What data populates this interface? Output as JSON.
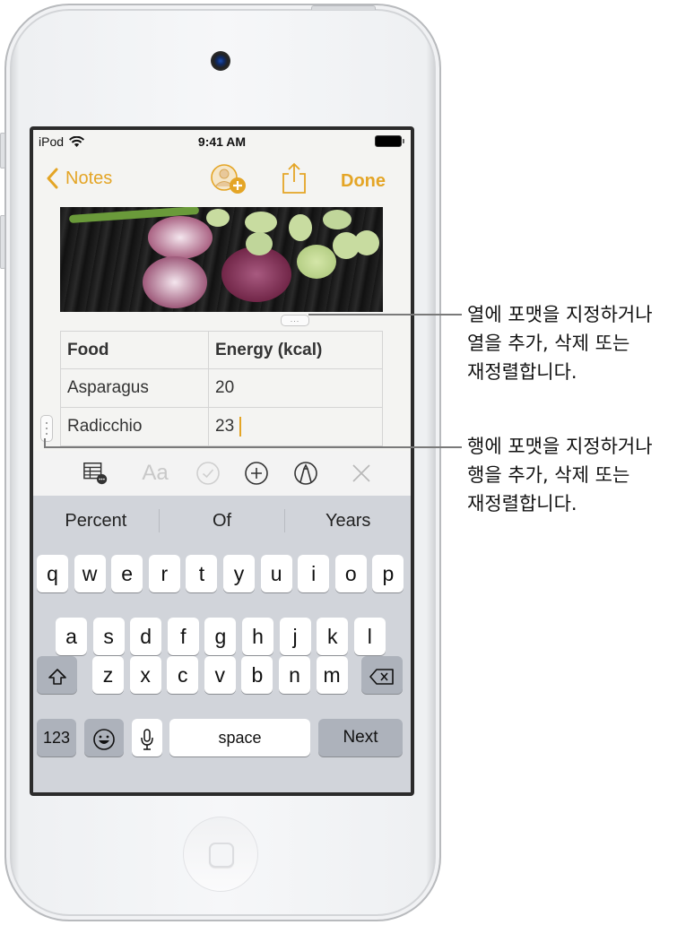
{
  "status_bar": {
    "carrier": "iPod",
    "time": "9:41 AM",
    "icons": [
      "wifi-icon",
      "battery-icon"
    ]
  },
  "nav_bar": {
    "back_label": "Notes",
    "done_label": "Done",
    "icons": [
      "chevron-left-icon",
      "add-collaborator-icon",
      "share-icon"
    ],
    "accent_color": "#e4a526"
  },
  "table": {
    "headers": [
      "Food",
      "Energy (kcal)"
    ],
    "rows": [
      [
        "Asparagus",
        "20"
      ],
      [
        "Radicchio",
        "23"
      ]
    ],
    "column_handle": "...",
    "row_handle": "..."
  },
  "format_toolbar": {
    "icons": [
      "table-options-icon",
      "text-format-icon",
      "checklist-icon",
      "add-icon",
      "markup-icon",
      "close-icon"
    ]
  },
  "keyboard": {
    "suggestions": [
      "Percent",
      "Of",
      "Years"
    ],
    "row1": [
      "q",
      "w",
      "e",
      "r",
      "t",
      "y",
      "u",
      "i",
      "o",
      "p"
    ],
    "row2": [
      "a",
      "s",
      "d",
      "f",
      "g",
      "h",
      "j",
      "k",
      "l"
    ],
    "row3": [
      "z",
      "x",
      "c",
      "v",
      "b",
      "n",
      "m"
    ],
    "numbers_label": "123",
    "space_label": "space",
    "next_label": "Next"
  },
  "callouts": [
    {
      "target": "column-handle",
      "text": "열에 포맷을 지정하거나\n열을 추가, 삭제 또는\n재정렬합니다."
    },
    {
      "target": "row-handle",
      "text": "행에 포맷을 지정하거나\n행을 추가, 삭제 또는\n재정렬합니다."
    }
  ]
}
